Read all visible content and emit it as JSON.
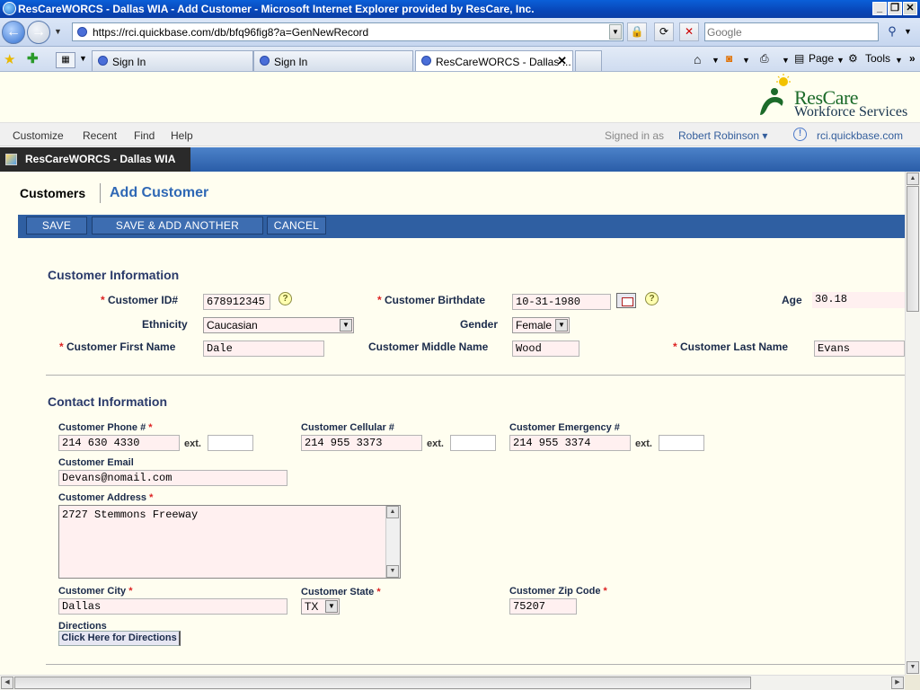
{
  "window": {
    "title": "ResCareWORCS - Dallas WIA - Add Customer - Microsoft Internet Explorer provided by ResCare, Inc."
  },
  "address_bar": {
    "url": "https://rci.quickbase.com/db/bfq96fig8?a=GenNewRecord",
    "search_placeholder": "Google"
  },
  "tabs": [
    {
      "label": "Sign In",
      "active": false
    },
    {
      "label": "Sign In",
      "active": false
    },
    {
      "label": "ResCareWORCS - Dallas ...",
      "active": true
    }
  ],
  "command_bar": {
    "page_label": "Page",
    "tools_label": "Tools"
  },
  "brand": {
    "logo_line1": "ResCare",
    "logo_line2": "Workforce Services",
    "logo_color": "#1c6b2a"
  },
  "qb_menu": {
    "items": [
      "Customize",
      "Recent",
      "Find",
      "Help"
    ],
    "signed_in_label": "Signed in as",
    "user": "Robert Robinson ▾",
    "site_link": "rci.quickbase.com"
  },
  "app": {
    "name": "ResCareWORCS - Dallas WIA"
  },
  "breadcrumb": {
    "table": "Customers",
    "action": "Add Customer"
  },
  "actions": {
    "save": "Save",
    "save_add_another": "Save & Add Another",
    "cancel": "Cancel"
  },
  "customer_info": {
    "heading": "Customer Information",
    "customer_id": {
      "label": "Customer ID#",
      "value": "678912345"
    },
    "birthdate": {
      "label": "Customer Birthdate",
      "value": "10-31-1980"
    },
    "age": {
      "label": "Age",
      "value": "30.18"
    },
    "ethnicity": {
      "label": "Ethnicity",
      "value": "Caucasian"
    },
    "gender": {
      "label": "Gender",
      "value": "Female"
    },
    "first_name": {
      "label": "Customer First Name",
      "value": "Dale"
    },
    "middle_name": {
      "label": "Customer Middle Name",
      "value": "Wood"
    },
    "last_name": {
      "label": "Customer Last Name",
      "value": "Evans"
    }
  },
  "contact_info": {
    "heading": "Contact Information",
    "ext_label": "ext.",
    "phone": {
      "label": "Customer Phone #",
      "value": "214 630 4330",
      "ext": ""
    },
    "cellular": {
      "label": "Customer Cellular #",
      "value": "214 955 3373",
      "ext": ""
    },
    "emergency": {
      "label": "Customer Emergency #",
      "value": "214 955 3374",
      "ext": ""
    },
    "email": {
      "label": "Customer Email",
      "value": "Devans@nomail.com"
    },
    "address": {
      "label": "Customer Address",
      "value": "2727 Stemmons Freeway"
    },
    "city": {
      "label": "Customer City",
      "value": "Dallas"
    },
    "state": {
      "label": "Customer State",
      "value": "TX"
    },
    "zip": {
      "label": "Customer Zip Code",
      "value": "75207"
    },
    "directions": {
      "label": "Directions",
      "button": "Click Here for Directions"
    }
  },
  "colors": {
    "accent": "#2f5fa2",
    "required_field_bg": "#fff0f0",
    "required_marker": "#d22222"
  }
}
